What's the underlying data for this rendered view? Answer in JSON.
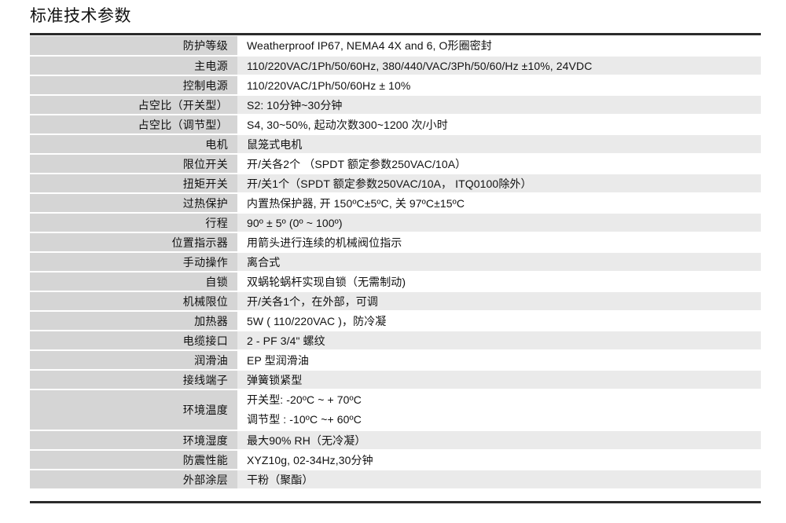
{
  "page_title": "标准技术参数",
  "table": {
    "rows": [
      {
        "label": "防护等级",
        "value": "Weatherproof IP67, NEMA4 4X and 6, O形圈密封"
      },
      {
        "label": "主电源",
        "value": "110/220VAC/1Ph/50/60Hz, 380/440/VAC/3Ph/50/60/Hz ±10%, 24VDC"
      },
      {
        "label": "控制电源",
        "value": "110/220VAC/1Ph/50/60Hz ± 10%"
      },
      {
        "label": "占空比（开关型）",
        "value": "S2: 10分钟~30分钟"
      },
      {
        "label": "占空比（调节型）",
        "value": "S4, 30~50%, 起动次数300~1200 次/小时"
      },
      {
        "label": "电机",
        "value": " 鼠笼式电机"
      },
      {
        "label": "限位开关",
        "value": "开/关各2个 （SPDT 额定参数250VAC/10A）"
      },
      {
        "label": "扭矩开关",
        "value": "开/关1个（SPDT 额定参数250VAC/10A， ITQ0100除外）"
      },
      {
        "label": "过热保护",
        "value": "内置热保护器, 开 150ºC±5ºC, 关 97ºC±15ºC"
      },
      {
        "label": "行程",
        "value": "90º ± 5º (0º ~ 100º)"
      },
      {
        "label": "位置指示器",
        "value": "用箭头进行连续的机械阀位指示"
      },
      {
        "label": "手动操作",
        "value": "离合式"
      },
      {
        "label": "自锁",
        "value": "双蜗轮蜗杆实现自锁（无需制动)"
      },
      {
        "label": "机械限位",
        "value": "开/关各1个，在外部，可调"
      },
      {
        "label": "加热器",
        "value": "5W ( 110/220VAC )，防冷凝"
      },
      {
        "label": "电缆接口",
        "value": "2 - PF 3/4\" 螺纹"
      },
      {
        "label": "润滑油",
        "value": "EP 型润滑油"
      },
      {
        "label": "接线端子",
        "value": "弹簧锁紧型"
      },
      {
        "label": "环境温度",
        "value_line1": "开关型: -20ºC ~ + 70ºC",
        "value_line2": "调节型 : -10ºC ~+ 60ºC"
      },
      {
        "label": "环境湿度",
        "value": "最大90% RH（无冷凝）"
      },
      {
        "label": "防震性能",
        "value": "XYZ10g, 02-34Hz,30分钟"
      },
      {
        "label": "外部涂层",
        "value": "干粉（聚酯）"
      }
    ]
  },
  "colors": {
    "label_bg": "#d5d5d5",
    "value_bg_alt": "#eaeaea",
    "value_bg": "#ffffff",
    "rule": "#2b2b2b",
    "text": "#121212"
  }
}
